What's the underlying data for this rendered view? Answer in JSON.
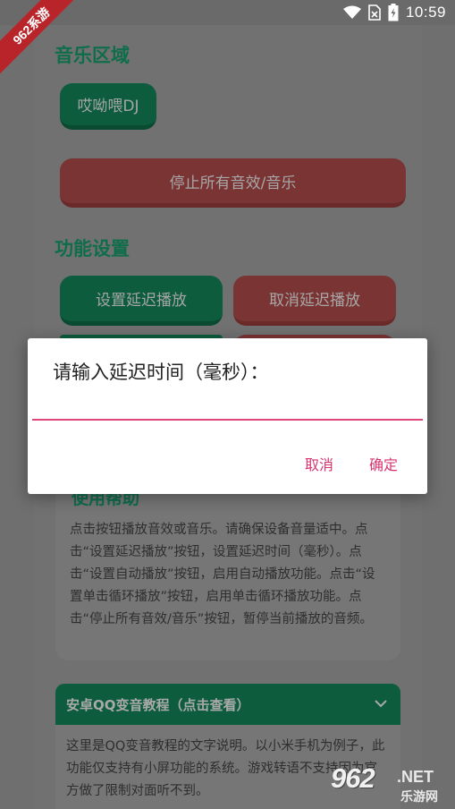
{
  "status_bar": {
    "time": "10:59"
  },
  "watermark": {
    "ribbon": "962系游"
  },
  "music_section": {
    "title": "音乐区域",
    "dj_button": "哎呦喂DJ",
    "stop_button": "停止所有音效/音乐"
  },
  "function_section": {
    "title": "功能设置",
    "set_delay_button": "设置延迟播放",
    "cancel_delay_button": "取消延迟播放"
  },
  "help": {
    "title": "使用帮助",
    "text": "点击按钮播放音效或音乐。请确保设备音量适中。点击“设置延迟播放”按钮，设置延迟时间（毫秒）。点击“设置自动播放”按钮，启用自动播放功能。点击“设置单击循环播放”按钮，启用单击循环播放功能。点击“停止所有音效/音乐”按钮，暂停当前播放的音频。"
  },
  "qq_tutorial": {
    "title": "安卓QQ变音教程（点击查看）",
    "text": "这里是QQ变音教程的文字说明。以小米手机为例子，此功能仅支持有小屏功能的系统。游戏转语不支持因为官方做了限制对面听不到。"
  },
  "dialog": {
    "title": "请输入延迟时间（毫秒）：",
    "input_value": "",
    "cancel_label": "取消",
    "confirm_label": "确定"
  },
  "logo": {
    "main": "962",
    "net": ".NET",
    "sub": "乐游网"
  },
  "colors": {
    "accent": "#d6336f",
    "green": "#0f6d4c",
    "red": "#7a3434"
  }
}
